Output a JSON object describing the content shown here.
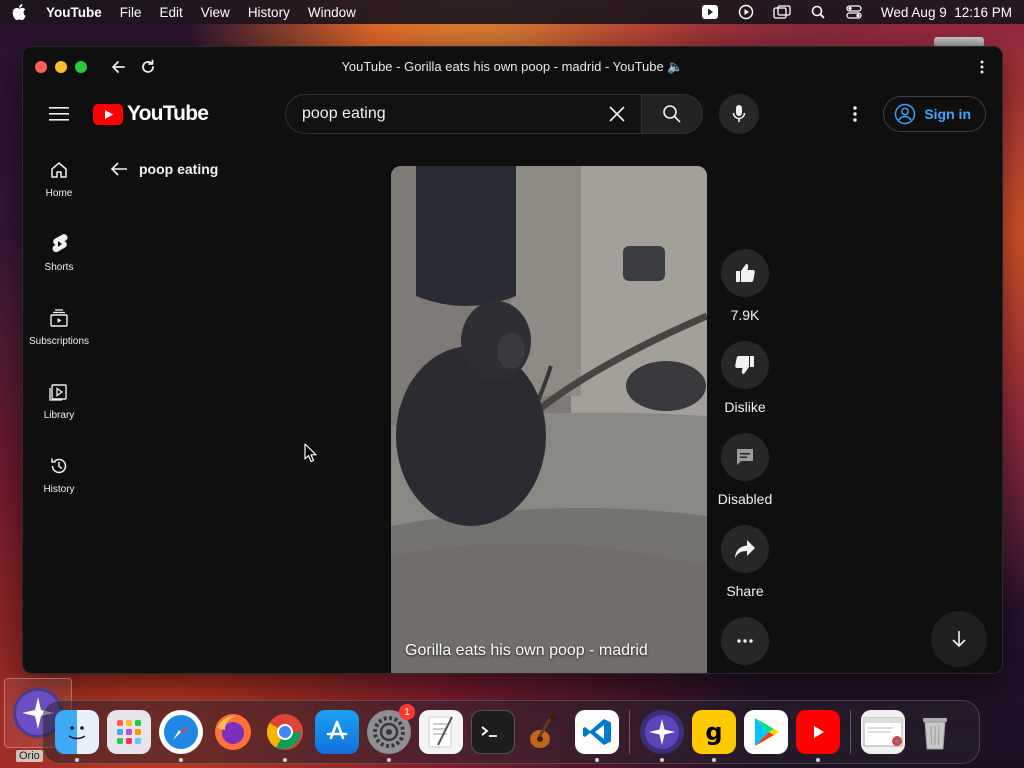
{
  "menubar": {
    "app_name": "YouTube",
    "items": [
      "File",
      "Edit",
      "View",
      "History",
      "Window"
    ],
    "datetime": "Wed Aug 9  12:16 PM"
  },
  "window": {
    "title": "YouTube - Gorilla eats his own poop - madrid - YouTube 🔈"
  },
  "header": {
    "logo_text": "YouTube",
    "search": {
      "value": "poop eating",
      "placeholder": "Search"
    },
    "signin_label": "Sign in"
  },
  "sidebar": {
    "items": [
      {
        "label": "Home",
        "icon": "home-icon"
      },
      {
        "label": "Shorts",
        "icon": "shorts-icon"
      },
      {
        "label": "Subscriptions",
        "icon": "subscriptions-icon"
      },
      {
        "label": "Library",
        "icon": "library-icon"
      },
      {
        "label": "History",
        "icon": "history-icon"
      }
    ]
  },
  "main": {
    "back_label": "poop eating",
    "video_title": "Gorilla eats his own poop - madrid",
    "actions": {
      "like": "7.9K",
      "dislike": "Dislike",
      "comments": "Disabled",
      "share": "Share"
    }
  },
  "desktop": {
    "orion_label": "Orio"
  },
  "dock": {
    "apps": [
      "Finder",
      "Launchpad",
      "Safari",
      "Firefox",
      "Chrome",
      "App Store",
      "System Settings",
      "TextEdit",
      "Terminal",
      "GarageBand",
      "VS Code",
      "Orion",
      "Gumroad",
      "Play Store",
      "YouTube",
      "Chrome Window",
      "Trash"
    ],
    "settings_badge": "1"
  },
  "colors": {
    "youtube_red": "#ff0000",
    "link_blue": "#3ea6ff",
    "bg_dark": "#0f0f0f"
  }
}
